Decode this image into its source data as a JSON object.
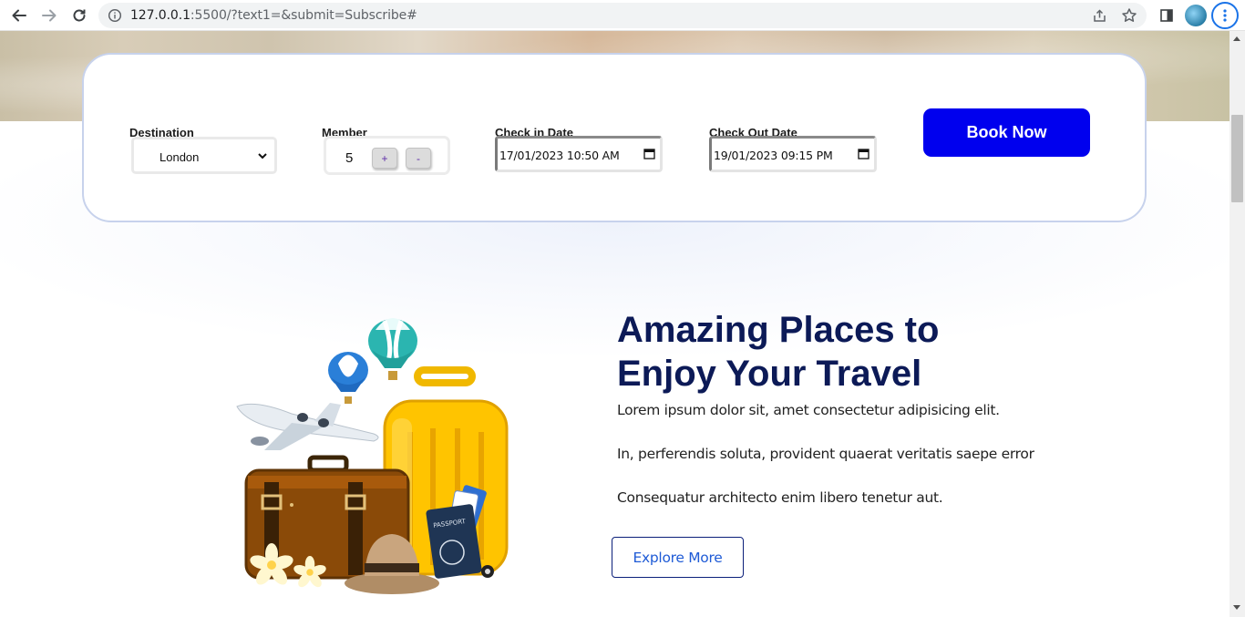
{
  "browser": {
    "url_host": "127.0.0.1",
    "url_rest": ":5500/?text1=&submit=Subscribe#",
    "icons": [
      "back-arrow-icon",
      "forward-arrow-icon",
      "reload-icon",
      "info-icon",
      "share-icon",
      "star-icon",
      "sidepanel-icon",
      "profile-avatar",
      "menu-dots-icon"
    ]
  },
  "booking": {
    "destination_label": "Destination",
    "destination_value": "London",
    "member_label": "Member",
    "member_value": "5",
    "plus_label": "+",
    "minus_label": "-",
    "checkin_label": "Check in Date",
    "checkin_value": "17/01/2023 10:50  AM",
    "checkout_label": "Check Out Date",
    "checkout_value": "19/01/2023 09:15  PM",
    "book_label": "Book Now"
  },
  "promo": {
    "heading_line1": "Amazing Places to",
    "heading_line2": "Enjoy Your Travel",
    "para1": "Lorem ipsum dolor sit, amet consectetur adipisicing elit.",
    "para2": "In, perferendis soluta, provident quaerat veritatis saepe error",
    "para3": "Consequatur architecto enim libero tenetur aut.",
    "explore_label": "Explore More",
    "passport_text": "PASSPORT"
  },
  "colors": {
    "book_button": "#0000ee",
    "heading": "#0c1a57",
    "explore_text": "#1f5bd6"
  }
}
